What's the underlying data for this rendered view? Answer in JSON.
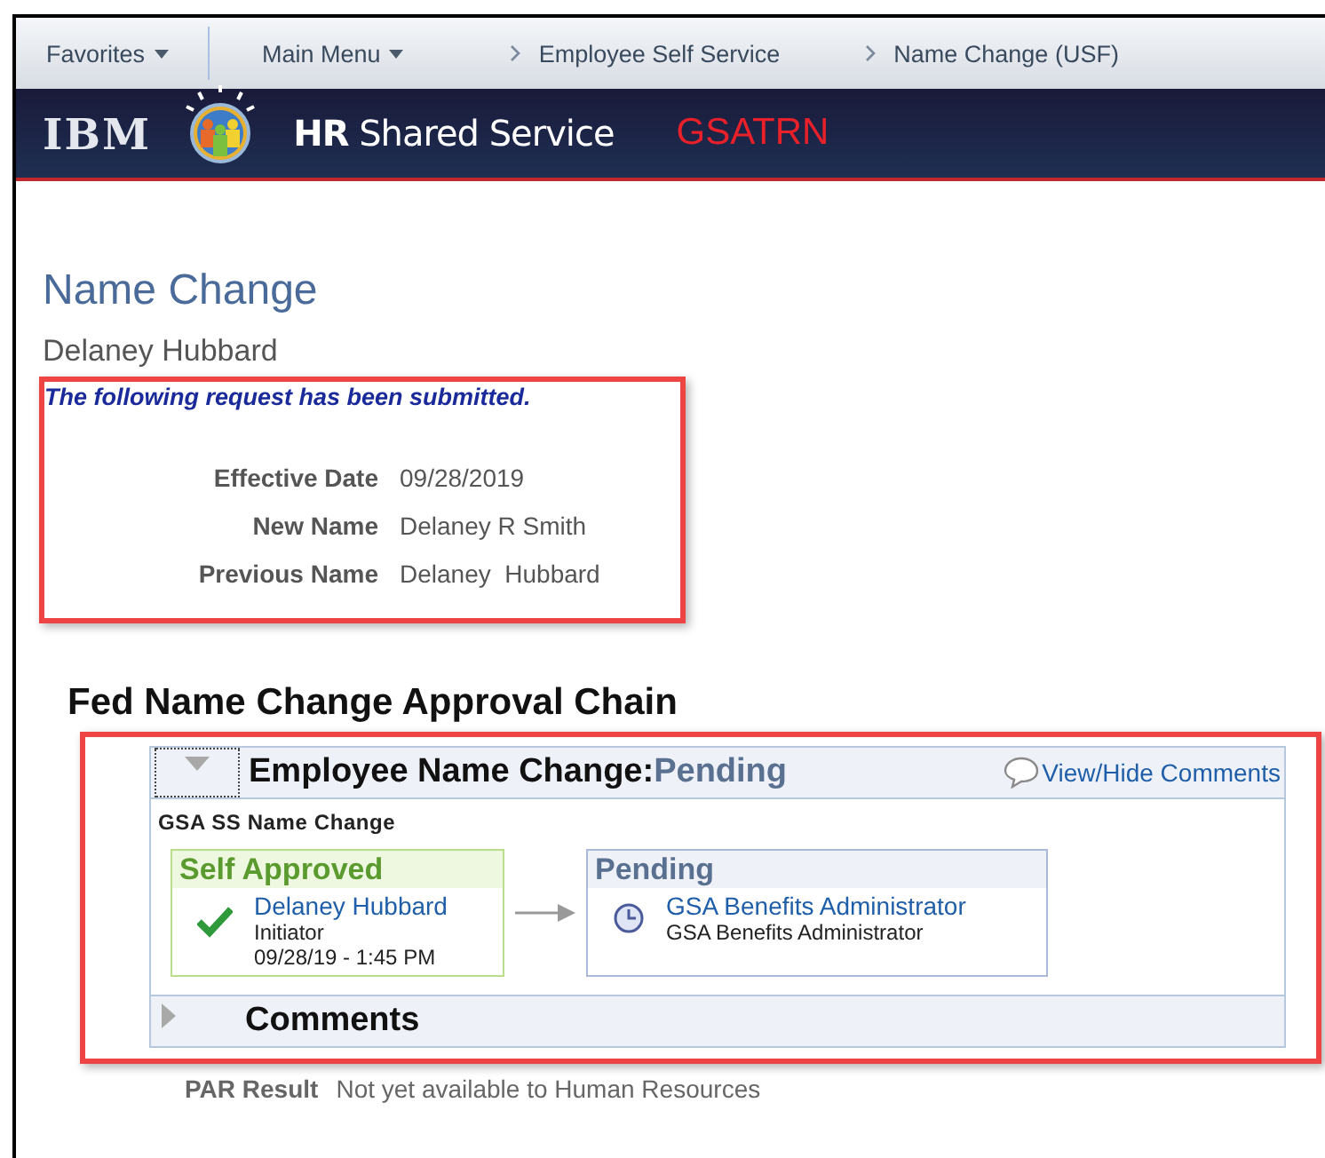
{
  "nav": [
    {
      "label": "Favorites",
      "kind": "menu"
    },
    {
      "label": "Main Menu",
      "kind": "menu"
    },
    {
      "label": "Employee Self Service",
      "kind": "crumb"
    },
    {
      "label": "Name Change (USF)",
      "kind": "crumb"
    }
  ],
  "header": {
    "logo": "IBM",
    "brand": "**HR** Shared Service",
    "environment": "GSATRN"
  },
  "page_title": "Name Change",
  "employee": "Delaney Hubbard",
  "message": "The following request has been submitted.",
  "fields": [
    {
      "label": "Effective Date",
      "value": "09/28/2019"
    },
    {
      "label": "New Name",
      "value": "Delaney R Smith"
    },
    {
      "label": "Previous Name",
      "value": "Delaney  Hubbard"
    }
  ],
  "chain_title": "Fed Name Change Approval Chain",
  "approval": {
    "expanded": true,
    "title": "Employee Name Change:",
    "status": "Pending",
    "comments_link": "View/Hide Comments",
    "subtitle": "GSA SS Name Change",
    "steps": [
      {
        "kind": "approved",
        "status": "Self Approved",
        "name": "Delaney Hubbard",
        "role": "Initiator",
        "time": "09/28/19 - 1:45 PM"
      },
      {
        "kind": "pending",
        "status": "Pending",
        "name": "GSA Benefits Administrator",
        "role": "GSA Benefits Administrator"
      }
    ],
    "comments": {
      "label": "Comments",
      "expanded": false
    }
  },
  "par": {
    "label": "PAR Result",
    "value": "Not yet available to Human Resources"
  }
}
